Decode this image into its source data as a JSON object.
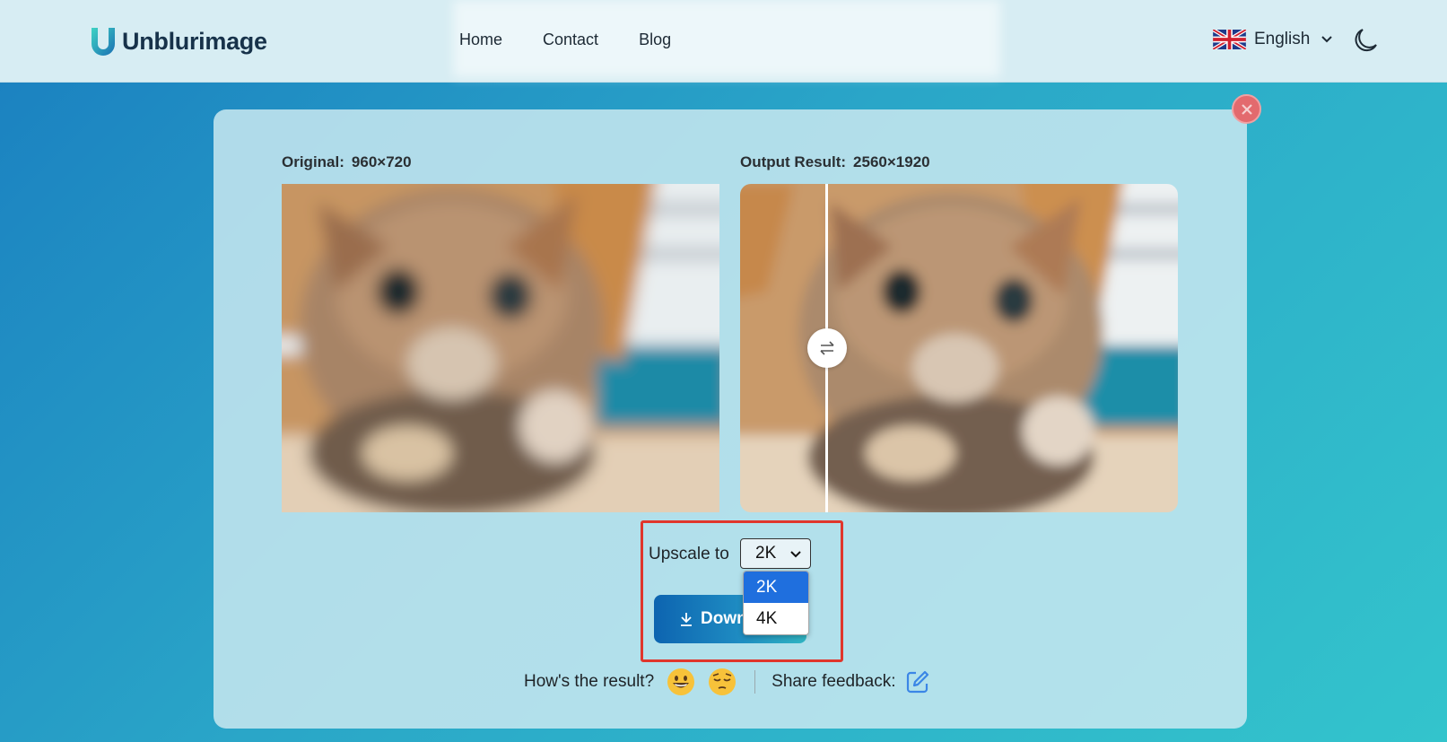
{
  "header": {
    "logo_text": "Unblurimage",
    "nav": [
      "Home",
      "Contact",
      "Blog"
    ],
    "language": "English",
    "flag_icon": "uk-flag-icon",
    "theme_icon": "moon-icon"
  },
  "comparison": {
    "original_label": "Original:",
    "original_dims": "960×720",
    "output_label": "Output Result:",
    "output_dims": "2560×1920"
  },
  "controls": {
    "upscale_label": "Upscale to",
    "selected": "2K",
    "options": [
      "2K",
      "4K"
    ],
    "download_label": "Down"
  },
  "feedback": {
    "question": "How's the result?",
    "share_label": "Share feedback:"
  },
  "colors": {
    "accent": "#1f6fde",
    "highlight": "#e0362c",
    "close": "#e36a6e"
  }
}
